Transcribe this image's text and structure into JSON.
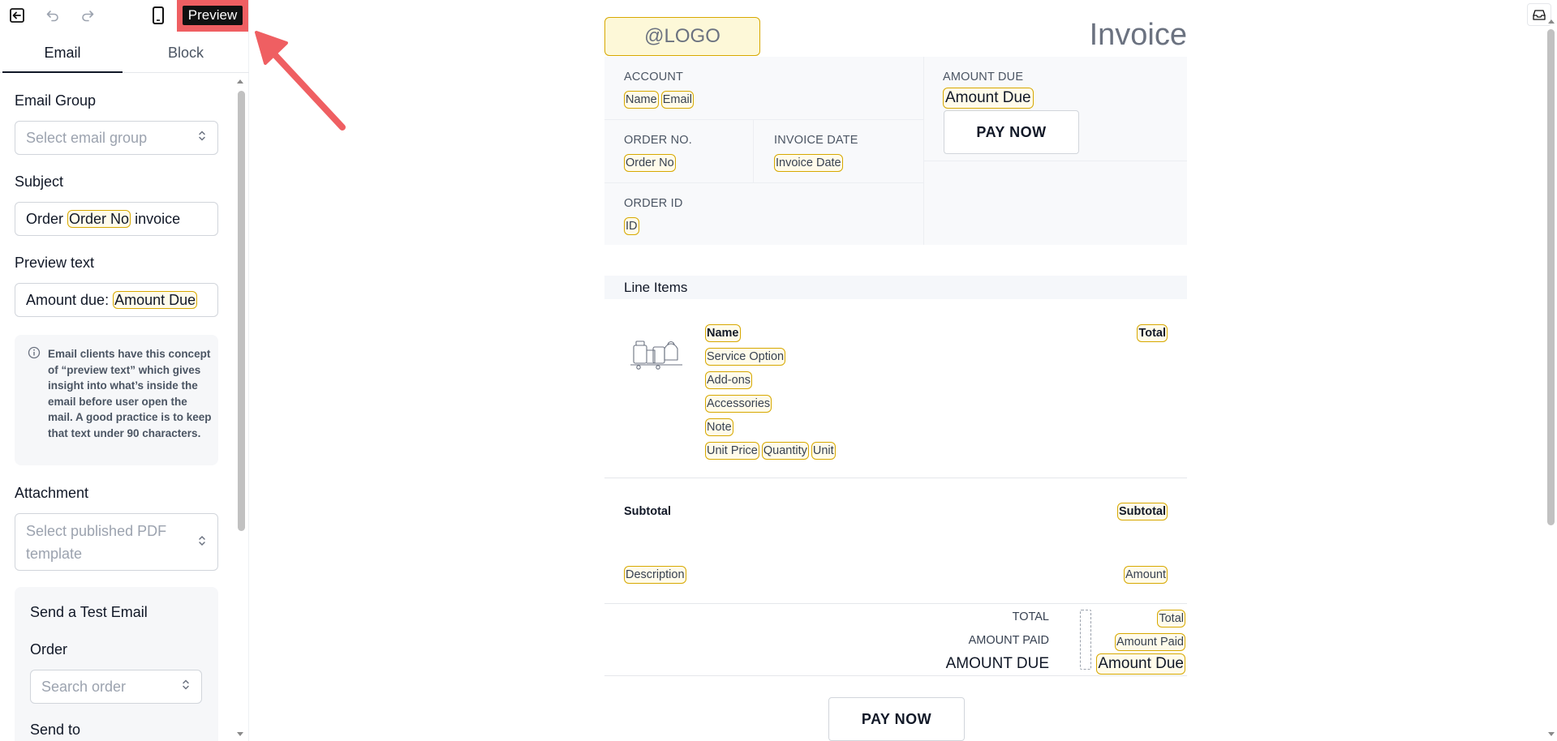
{
  "topbar": {
    "icons": [
      "exit-icon",
      "undo-icon",
      "redo-icon",
      "mobile-icon"
    ],
    "preview_label": "Preview"
  },
  "tabs": [
    {
      "label": "Email",
      "active": true
    },
    {
      "label": "Block",
      "active": false
    }
  ],
  "settings": {
    "email_group": {
      "label": "Email Group",
      "placeholder": "Select email group"
    },
    "subject": {
      "label": "Subject",
      "prefix": "Order",
      "tag": "Order No",
      "suffix": "invoice"
    },
    "preview_text": {
      "label": "Preview text",
      "prefix": "Amount due:",
      "tag": "Amount Due"
    },
    "info": "Email clients have this concept of “preview text” which gives insight into what’s inside the email before user open the mail. A good practice is to keep that text under 90 characters.",
    "attachment": {
      "label": "Attachment",
      "placeholder": "Select published PDF template"
    },
    "test_email": {
      "title": "Send a Test Email",
      "order_label": "Order",
      "order_placeholder": "Search order",
      "send_to_label": "Send to"
    }
  },
  "invoice": {
    "logo": "@LOGO",
    "title": "Invoice",
    "account": {
      "label": "ACCOUNT",
      "tags": [
        "Name",
        "Email"
      ]
    },
    "amount_due": {
      "label": "AMOUNT DUE",
      "tag": "Amount Due"
    },
    "pay_now": "PAY NOW",
    "order_no": {
      "label": "ORDER NO.",
      "tag": "Order No"
    },
    "invoice_date": {
      "label": "INVOICE DATE",
      "tag": "Invoice Date"
    },
    "order_id": {
      "label": "ORDER ID",
      "tag": "ID"
    },
    "line_items": {
      "title": "Line Items",
      "name_tag": "Name",
      "total_tag": "Total",
      "detail_tags": [
        "Service Option",
        "Add-ons",
        "Accessories",
        "Note"
      ],
      "price_tags": [
        "Unit Price",
        "Quantity",
        "Unit"
      ]
    },
    "subtotal": {
      "label": "Subtotal",
      "tag": "Subtotal"
    },
    "fee": {
      "description_tag": "Description",
      "amount_tag": "Amount"
    },
    "totals": [
      {
        "label": "TOTAL",
        "tag": "Total"
      },
      {
        "label": "AMOUNT PAID",
        "tag": "Amount Paid"
      },
      {
        "label": "AMOUNT DUE",
        "tag": "Amount Due"
      }
    ]
  },
  "colors": {
    "highlight": "#ef5f62",
    "tag_border": "#d7a800",
    "tag_bg": "#fffbea",
    "preview_bg": "#111111"
  }
}
